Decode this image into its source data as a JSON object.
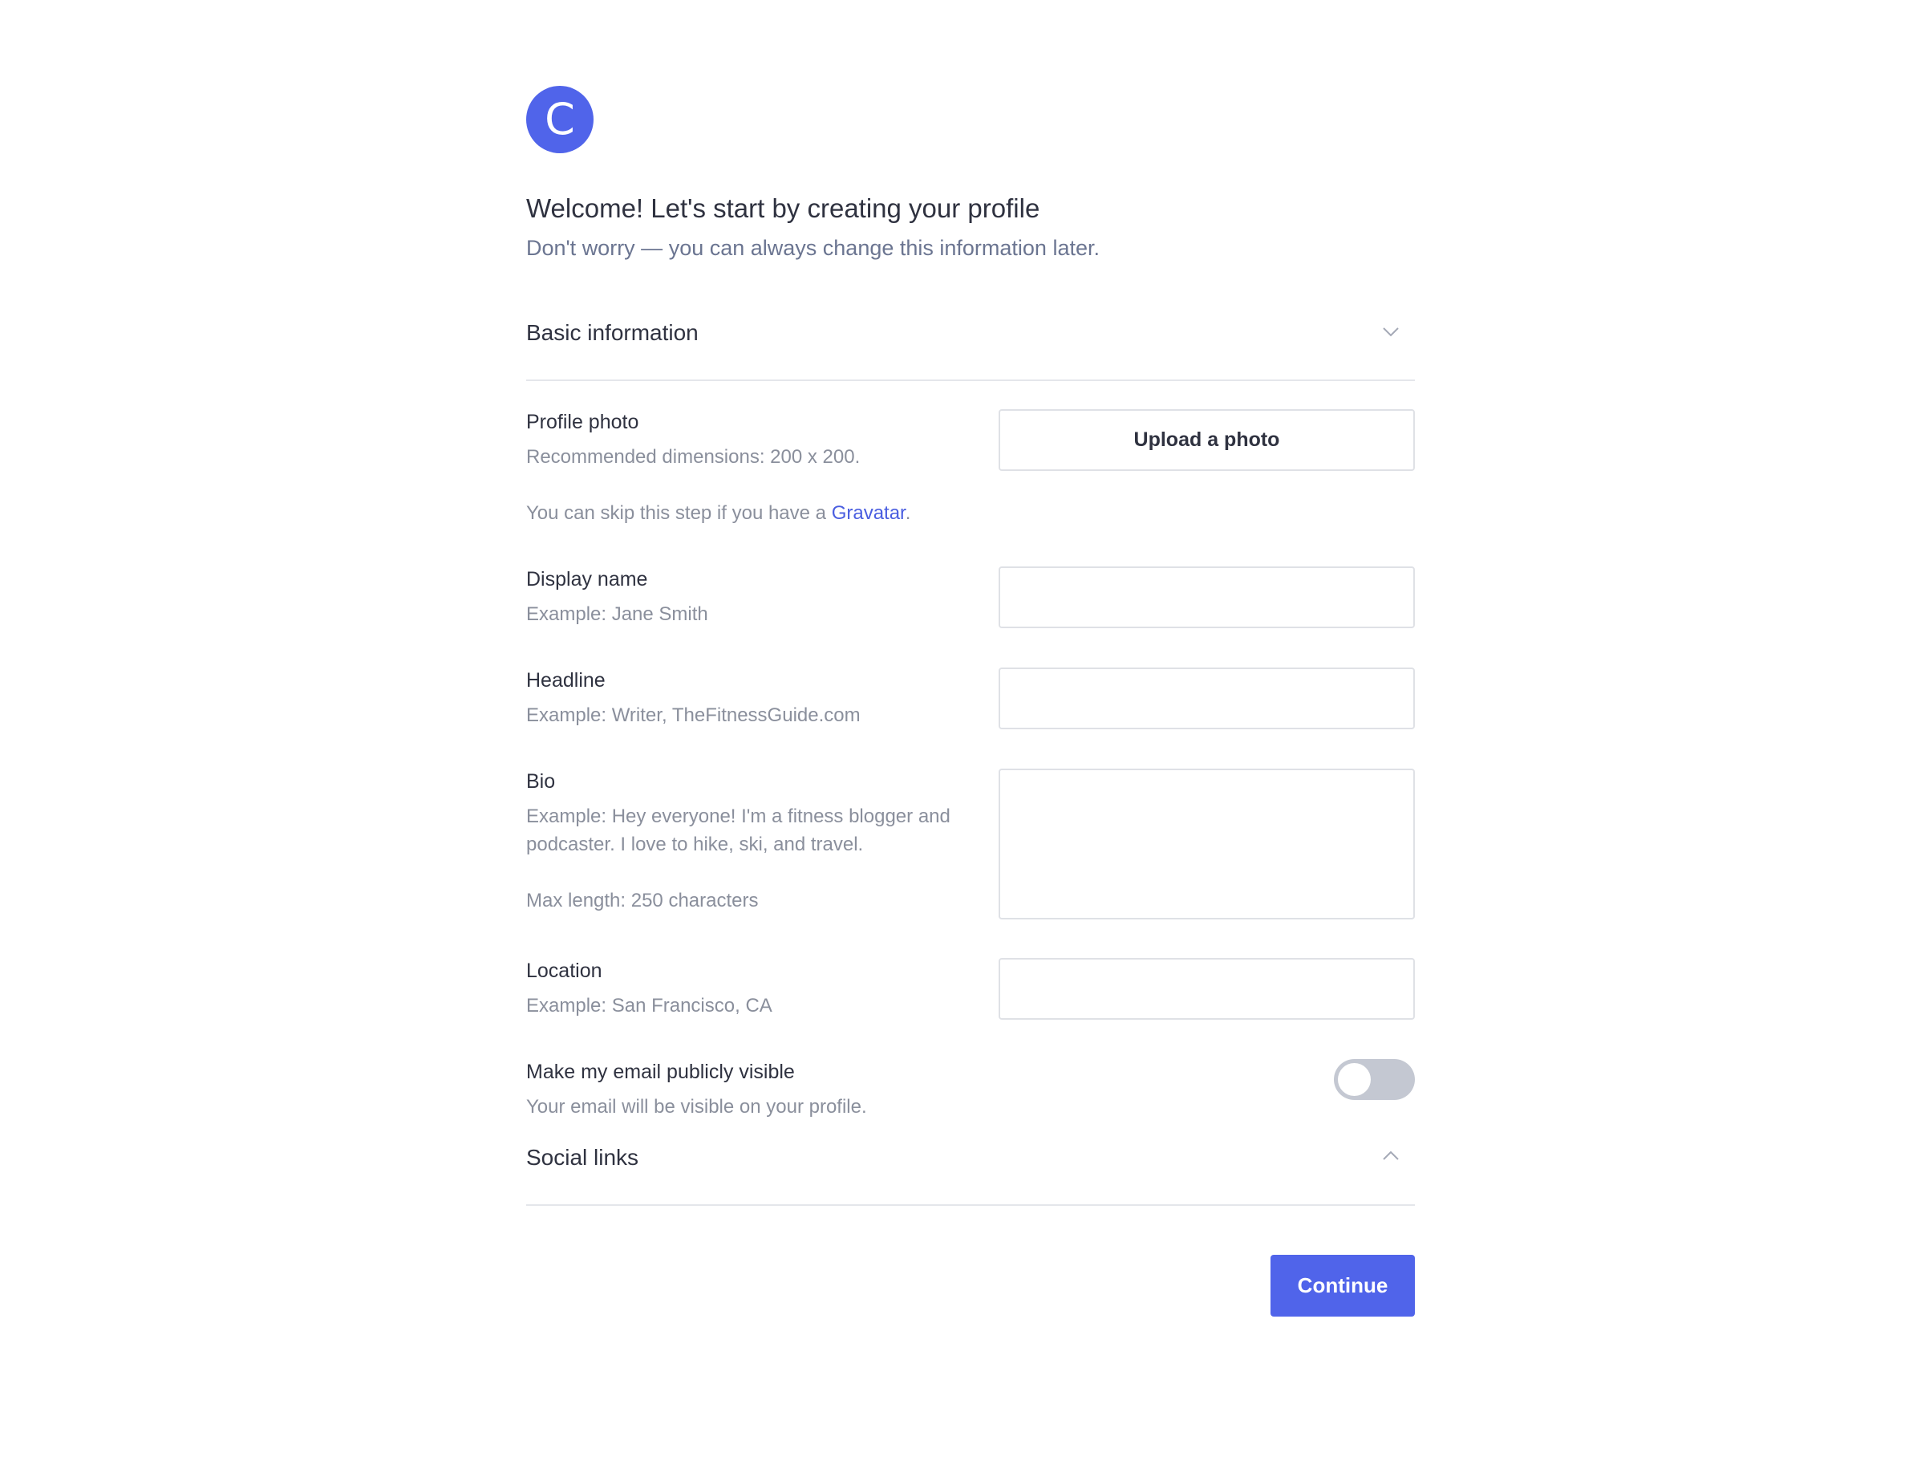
{
  "brand": {
    "logo_letter": "C",
    "accent_color": "#5064ea"
  },
  "header": {
    "title": "Welcome! Let's start by creating your profile",
    "subtitle": "Don't worry — you can always change this information later."
  },
  "sections": {
    "basic": {
      "label": "Basic information",
      "icon": "chevron-down-icon"
    },
    "social": {
      "label": "Social links",
      "icon": "chevron-up-icon"
    }
  },
  "fields": {
    "profile_photo": {
      "label": "Profile photo",
      "help": "Recommended dimensions: 200 x 200.",
      "skip_prefix": "You can skip this step if you have a ",
      "skip_link": "Gravatar",
      "skip_suffix": ".",
      "button": "Upload a photo"
    },
    "display_name": {
      "label": "Display name",
      "help": "Example: Jane Smith",
      "value": ""
    },
    "headline": {
      "label": "Headline",
      "help": "Example: Writer, TheFitnessGuide.com",
      "value": ""
    },
    "bio": {
      "label": "Bio",
      "help": "Example: Hey everyone! I'm a fitness blogger and podcaster. I love to hike, ski, and travel.",
      "max": "Max length: 250 characters",
      "value": ""
    },
    "location": {
      "label": "Location",
      "help": "Example: San Francisco, CA",
      "value": ""
    },
    "email_visible": {
      "label": "Make my email publicly visible",
      "help": "Your email will be visible on your profile.",
      "enabled": false
    }
  },
  "actions": {
    "continue": "Continue"
  }
}
